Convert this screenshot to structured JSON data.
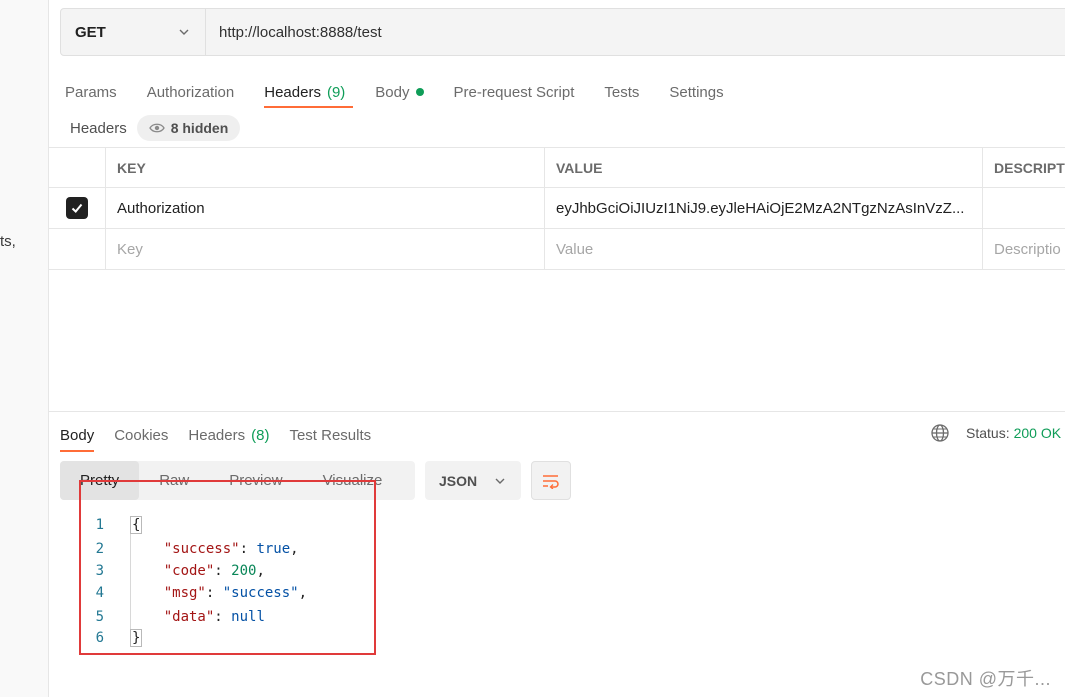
{
  "sidebar": {
    "fragment_text": "ts,"
  },
  "request": {
    "method": "GET",
    "url": "http://localhost:8888/test"
  },
  "request_tabs": [
    {
      "label": "Params"
    },
    {
      "label": "Authorization"
    },
    {
      "label": "Headers",
      "count": "(9)"
    },
    {
      "label": "Body"
    },
    {
      "label": "Pre-request Script"
    },
    {
      "label": "Tests"
    },
    {
      "label": "Settings"
    }
  ],
  "headers_section": {
    "label": "Headers",
    "hidden_count": "8 hidden",
    "columns": {
      "key": "KEY",
      "value": "VALUE",
      "description": "DESCRIPTI"
    },
    "rows": [
      {
        "checked": true,
        "key": "Authorization",
        "value": "eyJhbGciOiJIUzI1NiJ9.eyJleHAiOjE2MzA2NTgzNzAsInVzZ...",
        "description": ""
      }
    ],
    "placeholders": {
      "key": "Key",
      "value": "Value",
      "description": "Descriptio"
    }
  },
  "response_tabs": [
    {
      "label": "Body"
    },
    {
      "label": "Cookies"
    },
    {
      "label": "Headers",
      "count": "(8)"
    },
    {
      "label": "Test Results"
    }
  ],
  "status": {
    "label": "Status:",
    "value": "200 OK"
  },
  "view_modes": [
    {
      "label": "Pretty"
    },
    {
      "label": "Raw"
    },
    {
      "label": "Preview"
    },
    {
      "label": "Visualize"
    }
  ],
  "format_select": "JSON",
  "code": {
    "line_numbers": [
      "1",
      "2",
      "3",
      "4",
      "5",
      "6"
    ],
    "open_brace": "{",
    "close_brace": "}",
    "success_key": "\"success\"",
    "success_val": "true",
    "code_key": "\"code\"",
    "code_val": "200",
    "msg_key": "\"msg\"",
    "msg_val": "\"success\"",
    "data_key": "\"data\"",
    "data_val": "null",
    "colon": ": ",
    "comma": ","
  },
  "watermark": "CSDN @万千...",
  "colors": {
    "accent": "#ff6c37",
    "success": "#0f9d58",
    "annotation": "#e03a3a"
  },
  "icons": [
    "chevron-down-icon",
    "eye-icon",
    "check-icon",
    "globe-icon",
    "wrap-lines-icon"
  ]
}
